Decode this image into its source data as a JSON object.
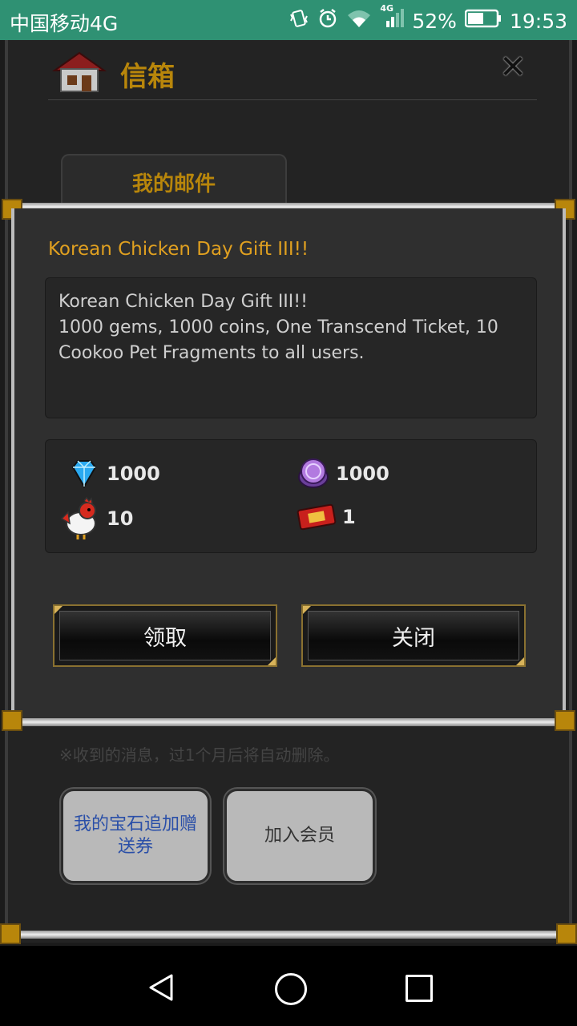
{
  "status_bar": {
    "carrier": "中国移动4G",
    "network_badge": "4G",
    "battery": "52%",
    "time": "19:53",
    "icons": [
      "vibrate-icon",
      "alarm-icon",
      "wifi-icon",
      "signal-icon",
      "battery-icon"
    ]
  },
  "mailbox": {
    "title": "信箱",
    "tab_label": "我的邮件",
    "note": "※收到的消息，过1个月后将自动删除。",
    "gem_voucher_button": "我的宝石追加赠送券",
    "join_member_button": "加入会员"
  },
  "mail_dialog": {
    "title": "Korean Chicken Day Gift III!!",
    "body_line1": "Korean Chicken Day Gift III!!",
    "body_line2": "1000 gems, 1000 coins, One Transcend Ticket, 10",
    "body_line3": "Cookoo Pet Fragments to all users.",
    "rewards": [
      {
        "icon": "gem-icon",
        "value": "1000"
      },
      {
        "icon": "coin-icon",
        "value": "1000"
      },
      {
        "icon": "chicken-pet-icon",
        "value": "10"
      },
      {
        "icon": "ticket-icon",
        "value": "1"
      }
    ],
    "claim_button": "领取",
    "close_button": "关闭"
  },
  "colors": {
    "status_bar_bg": "#2f9173",
    "title_gold": "#b8860b",
    "mail_title": "#e0a020",
    "gem_voucher_text": "#2a4fa8"
  }
}
